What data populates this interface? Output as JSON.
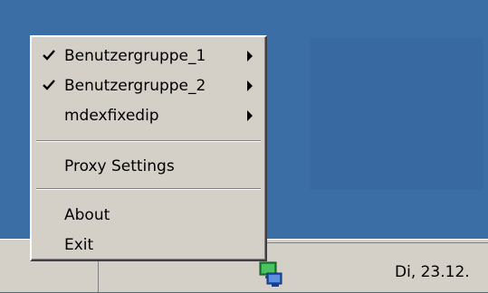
{
  "menu": {
    "items": [
      {
        "label": "Benutzergruppe_1",
        "checked": true,
        "submenu": true
      },
      {
        "label": "Benutzergruppe_2",
        "checked": true,
        "submenu": true
      },
      {
        "label": "mdexfixedip",
        "checked": false,
        "submenu": true
      }
    ],
    "proxy_settings_label": "Proxy Settings",
    "about_label": "About",
    "exit_label": "Exit"
  },
  "taskbar": {
    "clock": "Di, 23.12.",
    "tray_icon": "network-icon"
  },
  "colors": {
    "desktop": "#3a6ea5",
    "menu_bg": "#d4d0c8",
    "taskbar": "#d4d0c8"
  }
}
